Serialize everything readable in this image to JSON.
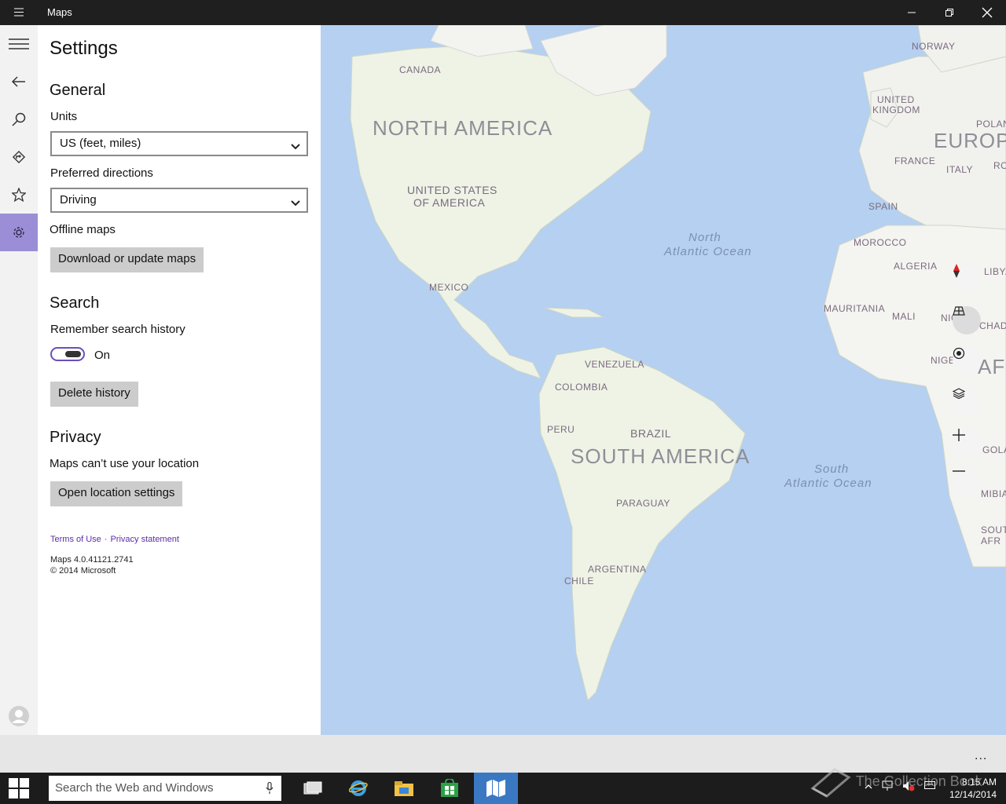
{
  "window": {
    "title": "Maps"
  },
  "settings": {
    "title": "Settings",
    "general": {
      "heading": "General",
      "units_label": "Units",
      "units_value": "US (feet, miles)",
      "directions_label": "Preferred directions",
      "directions_value": "Driving",
      "offline_label": "Offline maps",
      "offline_button": "Download or update maps"
    },
    "search": {
      "heading": "Search",
      "history_label": "Remember search history",
      "history_toggle": "On",
      "delete_button": "Delete history"
    },
    "privacy": {
      "heading": "Privacy",
      "location_text": "Maps can’t use your location",
      "location_button": "Open location settings"
    },
    "links": {
      "terms": "Terms of Use",
      "separator": "·",
      "privacy": "Privacy statement"
    },
    "version": {
      "line1": "Maps 4.0.41121.2741",
      "line2": "© 2014 Microsoft"
    }
  },
  "map_labels": {
    "continents": [
      "NORTH AMERICA",
      "SOUTH AMERICA",
      "EUROPE",
      "AFR"
    ],
    "countries": [
      "CANADA",
      "UNITED STATES",
      "OF AMERICA",
      "MEXICO",
      "VENEZUELA",
      "COLOMBIA",
      "PERU",
      "BRAZIL",
      "PARAGUAY",
      "ARGENTINA",
      "CHILE",
      "NORWAY",
      "UNITED",
      "KINGDOM",
      "POLAND",
      "FRANCE",
      "ITALY",
      "ROM",
      "SPAIN",
      "MOROCCO",
      "ALGERIA",
      "LIBYA",
      "MAURITANIA",
      "MALI",
      "NIGER",
      "CHAD",
      "NIGERIA",
      "GOLA",
      "MIBIA",
      "SOUTH",
      "AFR"
    ],
    "oceans": [
      "North",
      "Atlantic Ocean",
      "South",
      "Atlantic Ocean"
    ]
  },
  "map_controls": [
    "compass-icon",
    "tilt-icon",
    "locate-icon",
    "layers-icon",
    "zoom-in-icon",
    "zoom-out-icon"
  ],
  "appbar": {
    "more": "..."
  },
  "taskbar": {
    "search_placeholder": "Search the Web and Windows",
    "time": "8:15 AM",
    "date": "12/14/2014"
  },
  "watermark": "The Collection Book",
  "colors": {
    "accent": "#9b8ed6",
    "toggle": "#6b4fbb",
    "link": "#5b2fa6",
    "ocean": "#b5d0f0",
    "land": "#eef3e6",
    "taskbar_active": "#3a78c2"
  }
}
